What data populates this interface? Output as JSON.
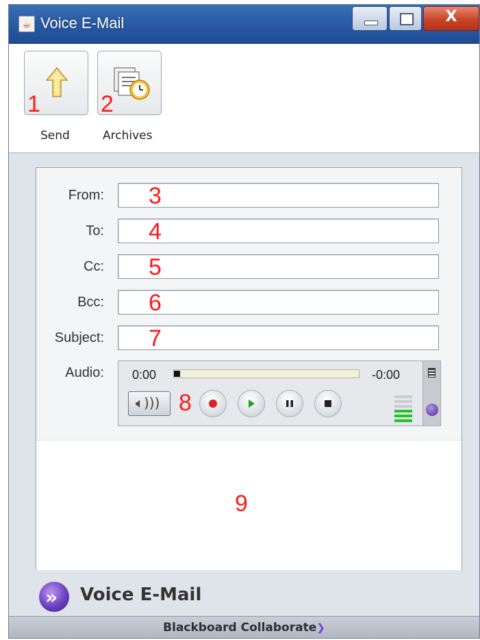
{
  "window": {
    "title": "Voice E-Mail",
    "controls": {
      "close_glyph": "X"
    }
  },
  "toolbar": {
    "send_label": "Send",
    "archives_label": "Archives",
    "send_marker": "1",
    "archives_marker": "2"
  },
  "form": {
    "fields": [
      {
        "label": "From:",
        "value": "",
        "marker": "3"
      },
      {
        "label": "To:",
        "value": "",
        "marker": "4"
      },
      {
        "label": "Cc:",
        "value": "",
        "marker": "5"
      },
      {
        "label": "Bcc:",
        "value": "",
        "marker": "6"
      },
      {
        "label": "Subject:",
        "value": "",
        "marker": "7"
      }
    ],
    "audio": {
      "label": "Audio:",
      "elapsed": "0:00",
      "remaining": "-0:00",
      "progress": 0,
      "marker": "8",
      "controls": [
        "record",
        "play",
        "pause",
        "stop"
      ]
    }
  },
  "message": {
    "marker": "9",
    "body": ""
  },
  "footer": {
    "title": "Voice E-Mail",
    "brand": "Blackboard Collaborate"
  },
  "colors": {
    "marker": "#ff1a1a",
    "record": "#e02020",
    "play": "#22a02a",
    "vu_green": "#22c22a",
    "brand_purple": "#6d3fc0"
  },
  "icons": {
    "send": "up-arrow-icon",
    "archives": "archive-clock-icon",
    "speaker": "speaker-icon",
    "collab": "collaborate-logo-icon"
  }
}
